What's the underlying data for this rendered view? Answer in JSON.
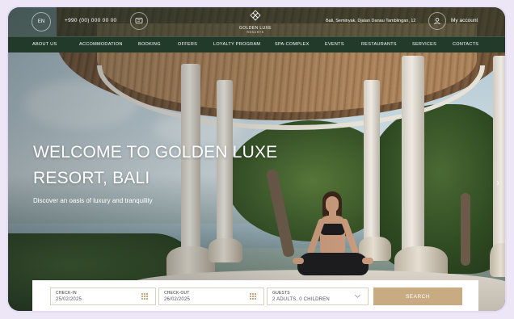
{
  "topbar": {
    "language": "EN",
    "phone": "+990 (00) 000 00 00",
    "logo_name": "GOLDEN LUXE",
    "logo_sub": "RESORTS",
    "address": "Bali, Seminyak, Djalan Danau Tamblingan, 12",
    "account_label": "My account"
  },
  "nav": {
    "items": [
      {
        "label": "ABOUT US"
      },
      {
        "label": "ACCOMMODATION"
      },
      {
        "label": "BOOKING"
      },
      {
        "label": "OFFERS"
      },
      {
        "label": "LOYALTY PROGRAM"
      },
      {
        "label": "SPA-COMPLEX"
      },
      {
        "label": "EVENTS"
      },
      {
        "label": "RESTAURANTS"
      },
      {
        "label": "SERVICES"
      },
      {
        "label": "CONTACTS"
      }
    ]
  },
  "hero": {
    "title_line1": "WELCOME TO GOLDEN LUXE",
    "title_line2": "RESORT, BALI",
    "subtitle": "Discover an oasis of luxury and tranquility"
  },
  "booking": {
    "checkin_label": "CHECK-IN",
    "checkin_value": "25/02/2025",
    "checkout_label": "CHECK-OUT",
    "checkout_value": "26/02/2025",
    "guests_label": "GUESTS",
    "guests_value": "2 ADULTS, 0 CHILDREN",
    "search_label": "SEARCH"
  },
  "colors": {
    "nav_bg": "#213a29",
    "accent": "#c8ab82"
  },
  "icons": [
    "chat-icon",
    "logo-icon",
    "user-icon",
    "calendar-icon",
    "chevron-down-icon",
    "chevron-right-icon"
  ]
}
